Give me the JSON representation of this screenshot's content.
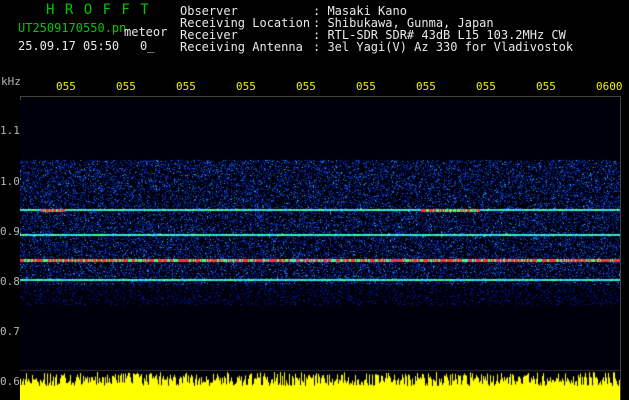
{
  "header": {
    "brand": "H R O F F T",
    "filename": "UT2509170550.pn",
    "tag": "meteor",
    "datetime": "25.09.17 05:50",
    "extra": "0_",
    "fields": [
      {
        "label": "Observer",
        "value": ": Masaki Kano"
      },
      {
        "label": "Receiving Location",
        "value": ": Shibukawa, Gunma, Japan"
      },
      {
        "label": "Receiver",
        "value": ": RTL-SDR SDR# 43dB L15 103.2MHz CW"
      },
      {
        "label": "Receiving Antenna",
        "value": ": 3el Yagi(V) Az 330 for Vladivostok"
      }
    ]
  },
  "y_axis": {
    "unit": "kHz",
    "ticks": [
      "1.1",
      "1.0",
      "0.9",
      "0.8",
      "0.7",
      "0.6"
    ]
  },
  "x_axis": {
    "ticks": [
      "055",
      "055",
      "055",
      "055",
      "055",
      "055",
      "055",
      "055",
      "055",
      "0600"
    ]
  },
  "spectrogram": {
    "freq_range_khz": [
      0.6,
      1.15
    ],
    "bands_khz": [
      0.94,
      0.89,
      0.84,
      0.8
    ],
    "colors": {
      "background": "#000010",
      "noise": "#0020a0",
      "signal": "#00d0ff",
      "strong": "#ff2030",
      "yellow": "#ffff00"
    }
  }
}
